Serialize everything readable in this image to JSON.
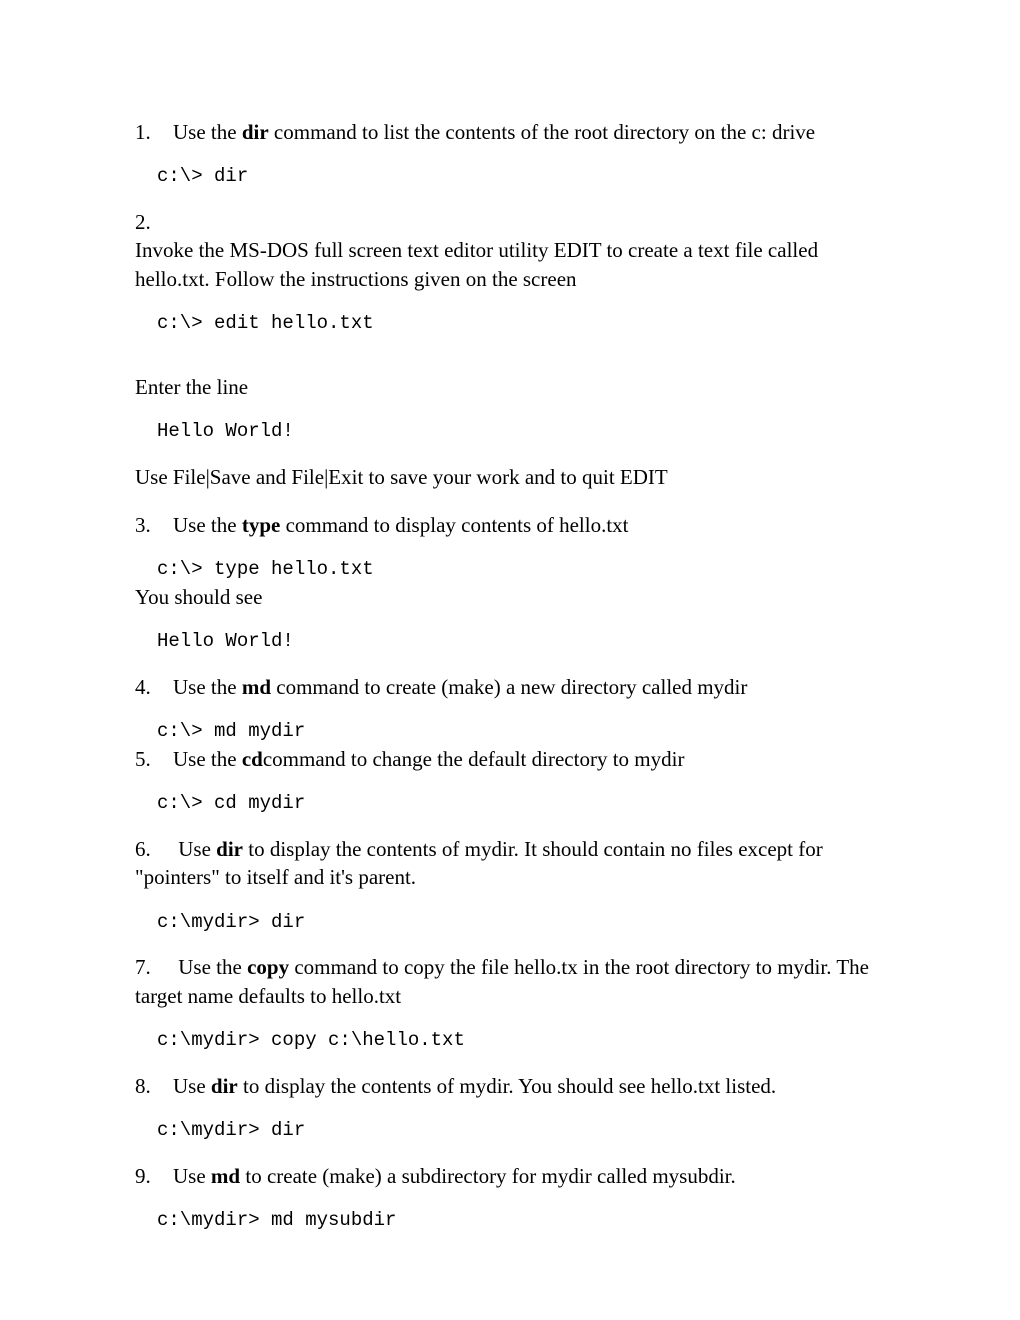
{
  "steps": [
    {
      "num": "1.",
      "pre": "Use the ",
      "bold": "dir",
      "post": " command to list the contents of the root directory on the c: drive",
      "code": "c:\\> dir"
    },
    {
      "num": "2.",
      "text": "Invoke the MS-DOS full screen text editor utility EDIT to create a text file called hello.txt. Follow the instructions given on the screen",
      "code": "c:\\> edit hello.txt",
      "after1": "Enter the line",
      "code2": "Hello World!",
      "after2": "Use File|Save and File|Exit to save your work and to quit EDIT"
    },
    {
      "num": "3.",
      "pre": "Use the ",
      "bold": "type",
      "post": " command to display contents of hello.txt",
      "code": "c:\\> type hello.txt",
      "after1": "You should see",
      "code2": "Hello World!"
    },
    {
      "num": "4.",
      "pre": "Use the ",
      "bold": "md",
      "post": " command to create (make) a new directory called mydir",
      "code": "c:\\> md mydir"
    },
    {
      "num": "5.",
      "pre": "Use the ",
      "bold": "cd",
      "post": "command to change the default directory to mydir",
      "code": "c:\\> cd mydir"
    },
    {
      "num": "6.",
      "pre": "Use ",
      "bold": "dir",
      "post": " to display the contents of mydir. It should contain no files except for \"pointers\" to itself and it's parent.",
      "code": "c:\\mydir> dir"
    },
    {
      "num": "7.",
      "pre": "Use the ",
      "bold": "copy",
      "post": " command to copy the file hello.tx in the root directory to mydir. The target name defaults to hello.txt",
      "code": "c:\\mydir> copy c:\\hello.txt"
    },
    {
      "num": "8.",
      "pre": "Use ",
      "bold": "dir",
      "post": " to display the contents of mydir. You should see hello.txt listed.",
      "code": "c:\\mydir> dir"
    },
    {
      "num": "9.",
      "pre": "Use ",
      "bold": "md",
      "post": " to create (make) a subdirectory for mydir called mysubdir.",
      "code": "c:\\mydir> md mysubdir"
    }
  ]
}
